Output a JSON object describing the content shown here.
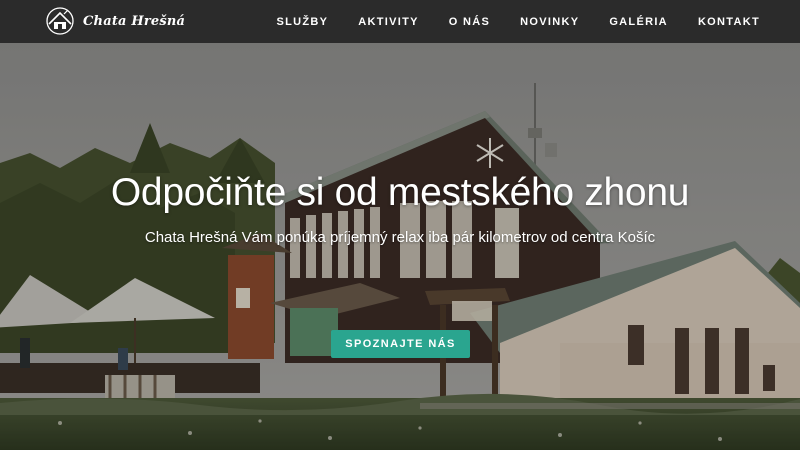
{
  "brand": {
    "name": "Chata Hrešná"
  },
  "nav": {
    "items": [
      {
        "label": "SLUŽBY"
      },
      {
        "label": "AKTIVITY"
      },
      {
        "label": "O NÁS"
      },
      {
        "label": "NOVINKY"
      },
      {
        "label": "GALÉRIA"
      },
      {
        "label": "KONTAKT"
      }
    ]
  },
  "hero": {
    "title": "Odpočiňte si od mestského zhonu",
    "subtitle": "Chata Hrešná Vám ponúka príjemný relax iba pár kilometrov od centra Košíc",
    "cta_label": "SPOZNAJTE NÁS"
  },
  "colors": {
    "header_bg": "#2b2b2b",
    "accent": "#2aa58f",
    "text_on_dark": "#ffffff"
  }
}
